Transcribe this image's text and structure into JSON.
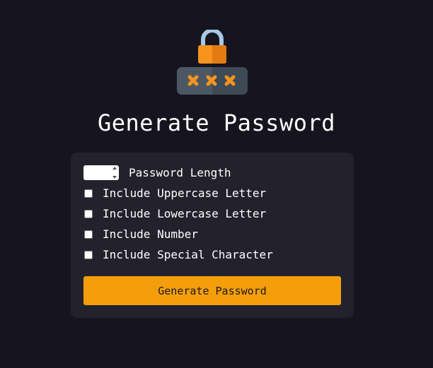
{
  "header": {
    "title": "Generate Password"
  },
  "options": {
    "length": {
      "label": "Password Length",
      "value": ""
    },
    "checkboxes": [
      {
        "label": "Include Uppercase Letter",
        "checked": false
      },
      {
        "label": "Include Lowercase Letter",
        "checked": false
      },
      {
        "label": "Include Number",
        "checked": false
      },
      {
        "label": "Include Special Character",
        "checked": false
      }
    ]
  },
  "actions": {
    "generate_label": "Generate Password"
  },
  "colors": {
    "background": "#16151f",
    "card": "#23222c",
    "accent": "#f49e0c",
    "lock_body": "#f7941d",
    "lock_shackle": "#a7c8e6",
    "password_field": "#4a5763"
  },
  "icons": {
    "logo": "lock-password-icon"
  }
}
